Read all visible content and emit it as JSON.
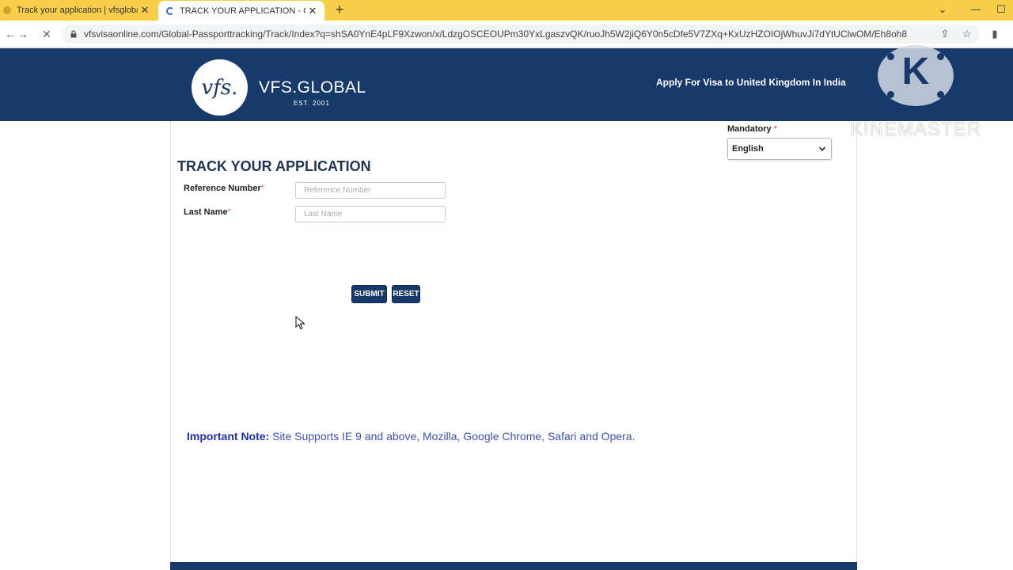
{
  "browser": {
    "tabs": [
      {
        "title": "Track your application | vfsglobal",
        "active": false
      },
      {
        "title": "TRACK YOUR APPLICATION - Ol",
        "active": true
      }
    ],
    "new_tab_glyph": "+",
    "url": "vfsvisaonline.com/Global-Passporttracking/Track/Index?q=shSA0YnE4pLF9Xzwon/x/LdzgOSCEOUPm30YxLgaszvQK/ruoJh5W2jiQ6Y0n5cDfe5V7ZXq+KxUzHZOIOjWhuvJi7dYtUClwOM/Eh8oh8"
  },
  "header": {
    "logo_mark": "vfs.",
    "brand": "VFS.GLOBAL",
    "established": "EST. 2001",
    "link_text": "Apply For Visa to United Kingdom  In India"
  },
  "watermark": {
    "letter": "K",
    "text": "KINEMASTER"
  },
  "language": {
    "label": "Mandatory",
    "required_mark": "*",
    "selected": "English"
  },
  "form": {
    "title": "TRACK YOUR APPLICATION",
    "fields": [
      {
        "label": "Reference Number",
        "placeholder": "Reference Number",
        "value": ""
      },
      {
        "label": "Last Name",
        "placeholder": "Last Name",
        "value": ""
      }
    ],
    "required_mark": "*",
    "submit_label": "SUBMIT",
    "reset_label": "RESET"
  },
  "note": {
    "label": "Important Note:",
    "text": "Site Supports IE 9 and above, Mozilla, Google Chrome, Safari and Opera."
  },
  "colors": {
    "brand_navy": "#183a6b",
    "tabbar": "#f7cf4a",
    "note_blue": "#3f51b5"
  },
  "icons": [
    "back-arrow-icon",
    "forward-arrow-icon",
    "stop-loading-icon",
    "lock-icon",
    "share-icon",
    "star-icon",
    "sidebar-icon",
    "chevron-down-icon",
    "close-icon",
    "minimize-icon",
    "maximize-icon",
    "cursor-arrow-icon"
  ]
}
